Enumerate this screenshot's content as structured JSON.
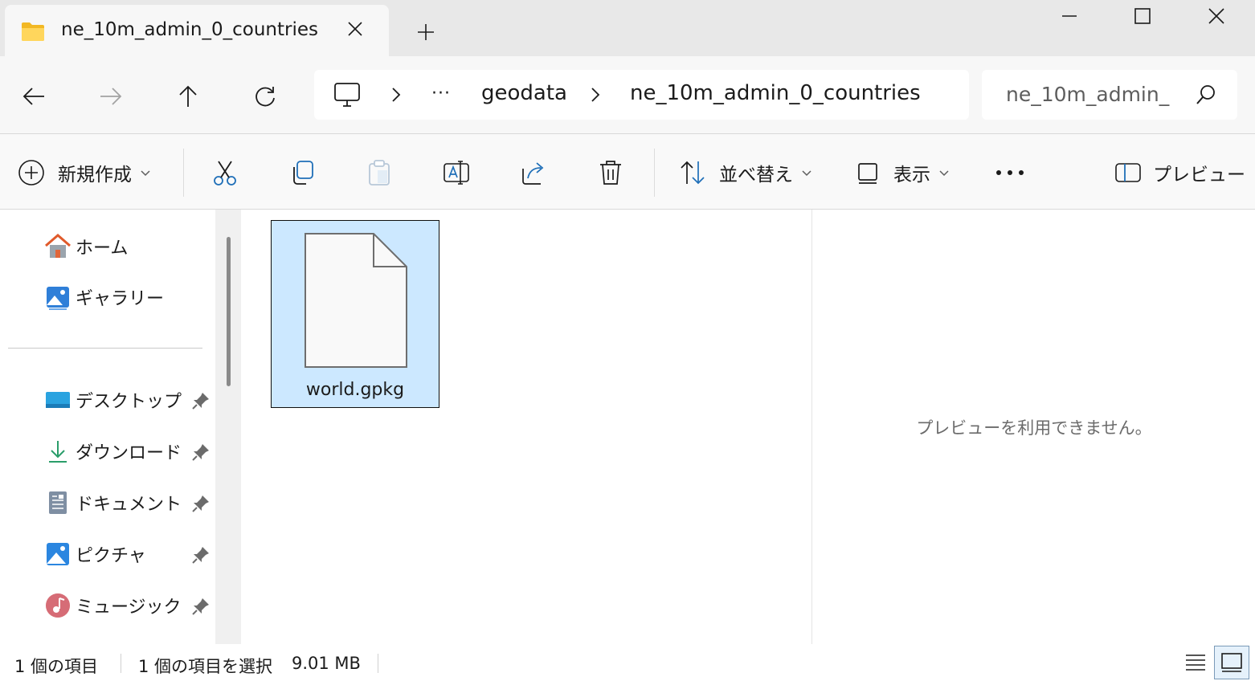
{
  "window": {
    "tab_title": "ne_10m_admin_0_countries",
    "tab_icon": "folder-icon",
    "controls": [
      "minimize-icon",
      "maximize-icon",
      "close-icon"
    ]
  },
  "address": {
    "breadcrumbs": [
      "geodata",
      "ne_10m_admin_0_countries"
    ],
    "overflow_label": "···",
    "root_icon": "this-pc-icon"
  },
  "search": {
    "placeholder": "ne_10m_admin_"
  },
  "toolbar": {
    "new_label": "新規作成",
    "sort_label": "並べ替え",
    "view_label": "表示",
    "more_label": "•••",
    "preview_label": "プレビュー"
  },
  "sidebar": {
    "items": [
      {
        "label": "ホーム",
        "icon": "home-icon"
      },
      {
        "label": "ギャラリー",
        "icon": "gallery-icon"
      },
      {
        "label": "デスクトップ",
        "icon": "desktop-icon",
        "pinned": true
      },
      {
        "label": "ダウンロード",
        "icon": "download-icon",
        "pinned": true
      },
      {
        "label": "ドキュメント",
        "icon": "documents-icon",
        "pinned": true
      },
      {
        "label": "ピクチャ",
        "icon": "pictures-icon",
        "pinned": true
      },
      {
        "label": "ミュージック",
        "icon": "music-icon",
        "pinned": true
      }
    ]
  },
  "files": [
    {
      "name": "world.gpkg",
      "selected": true,
      "icon": "generic-file-icon"
    }
  ],
  "preview": {
    "message": "プレビューを利用できません。"
  },
  "status": {
    "item_count": "1 個の項目",
    "selection": "1 個の項目を選択",
    "size": "9.01 MB"
  },
  "colors": {
    "selection_bg": "#cce8ff",
    "accent": "#0067c0"
  }
}
